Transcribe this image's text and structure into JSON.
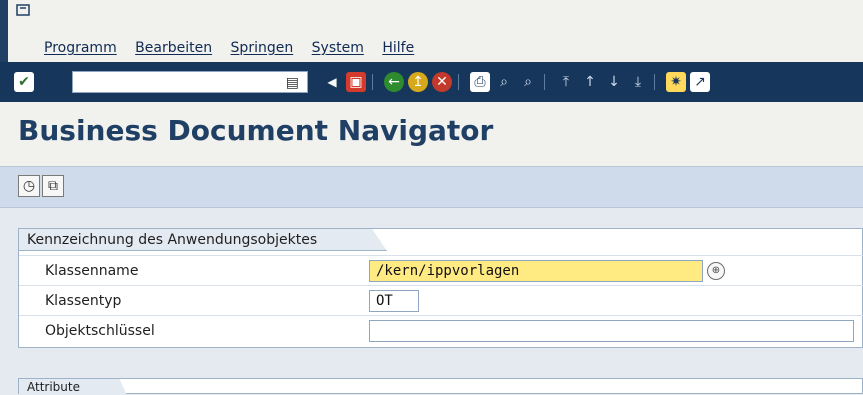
{
  "menu": [
    "Programm",
    "Bearbeiten",
    "Springen",
    "System",
    "Hilfe"
  ],
  "title": "Business Document Navigator",
  "groupbox": {
    "title": "Kennzeichnung des Anwendungsobjektes",
    "fields": [
      {
        "label": "Klassenname",
        "value": "/kern/ippvorlagen"
      },
      {
        "label": "Klassentyp",
        "value": "OT"
      },
      {
        "label": "Objektschlüssel",
        "value": ""
      }
    ]
  },
  "groupbox2": {
    "title": "Attribute"
  }
}
